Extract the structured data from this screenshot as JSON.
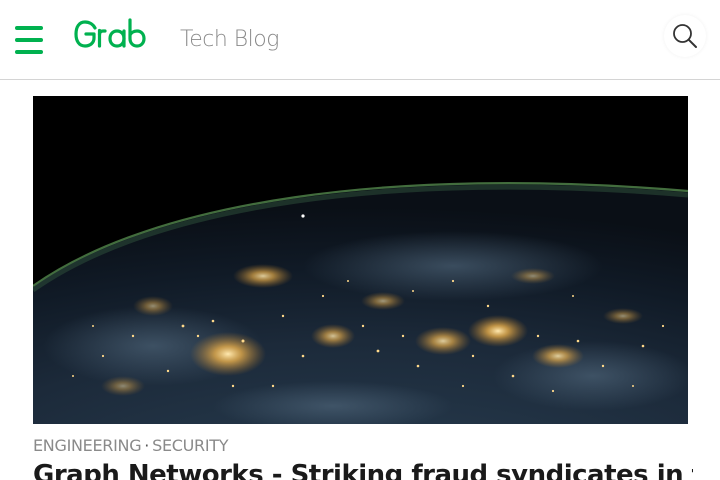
{
  "header": {
    "brand": "Grab",
    "brand_sub": "Tech Blog",
    "brand_color": "#00b14f"
  },
  "icons": {
    "menu": "hamburger-menu-icon",
    "search": "search-icon"
  },
  "article": {
    "tags": [
      "ENGINEERING",
      "SECURITY"
    ],
    "tag_separator": "·",
    "title": "Graph Networks - Striking fraud syndicates in the"
  }
}
